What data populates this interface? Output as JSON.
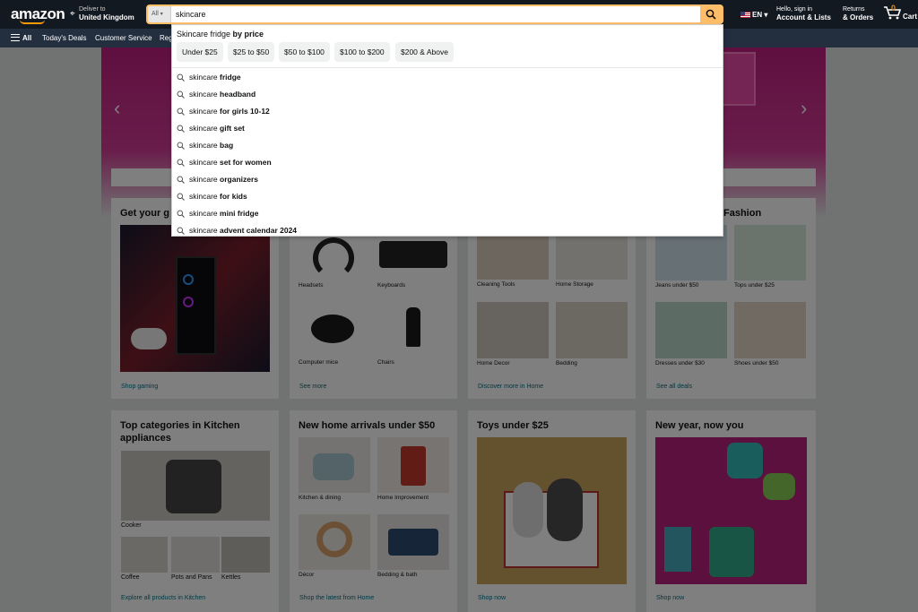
{
  "header": {
    "logo": "amazon",
    "deliver_to": "Deliver to",
    "deliver_location": "United Kingdom",
    "search_category": "All",
    "search_value": "skincare",
    "language": "EN",
    "account_line1": "Hello, sign in",
    "account_line2": "Account & Lists",
    "orders_line1": "Returns",
    "orders_line2": "& Orders",
    "cart_count": "0",
    "cart_label": "Cart"
  },
  "nav": {
    "all": "All",
    "items": [
      "Today's Deals",
      "Customer Service",
      "Reg"
    ]
  },
  "dropdown": {
    "header_prefix": "Skincare fridge",
    "header_bold": "by price",
    "chips": [
      "Under $25",
      "$25 to $50",
      "$50 to $100",
      "$100 to $200",
      "$200 & Above"
    ],
    "suggestion_prefix": "skincare",
    "suggestions": [
      "fridge",
      "headband",
      "for girls 10-12",
      "gift set",
      "bag",
      "set for women",
      "organizers",
      "for kids",
      "mini fridge",
      "advent calendar 2024"
    ]
  },
  "cards": {
    "gaming": {
      "title": "Get your g",
      "link": "Shop gaming"
    },
    "accessories": {
      "captions": [
        "Headsets",
        "Keyboards",
        "Computer mice",
        "Chairs"
      ],
      "link": "See more"
    },
    "home": {
      "captions": [
        "Cleaning Tools",
        "Home Storage",
        "Home Decor",
        "Bedding"
      ],
      "link": "Discover more in Home"
    },
    "fashion": {
      "title": "Fashion",
      "captions": [
        "Jeans under $50",
        "Tops under $25",
        "Dresses under $30",
        "Shoes under $50"
      ],
      "link": "See all deals"
    },
    "kitchen": {
      "title1": "Top categories in Kitchen",
      "title2": "appliances",
      "main_caption": "Cooker",
      "captions": [
        "Coffee",
        "Pots and Pans",
        "Kettles"
      ],
      "link": "Explore all products in Kitchen"
    },
    "arrivals": {
      "title": "New home arrivals under $50",
      "captions": [
        "Kitchen & dining",
        "Home Improvement",
        "Décor",
        "Bedding & bath"
      ],
      "link": "Shop the latest from Home"
    },
    "toys": {
      "title": "Toys under $25",
      "link": "Shop now"
    },
    "newyear": {
      "title": "New year, now you",
      "link": "Shop now"
    }
  },
  "colors": {
    "header_bg": "#131921",
    "nav_bg": "#232f3e",
    "accent": "#febd69",
    "link": "#007185",
    "hero": "#c01f7f"
  }
}
